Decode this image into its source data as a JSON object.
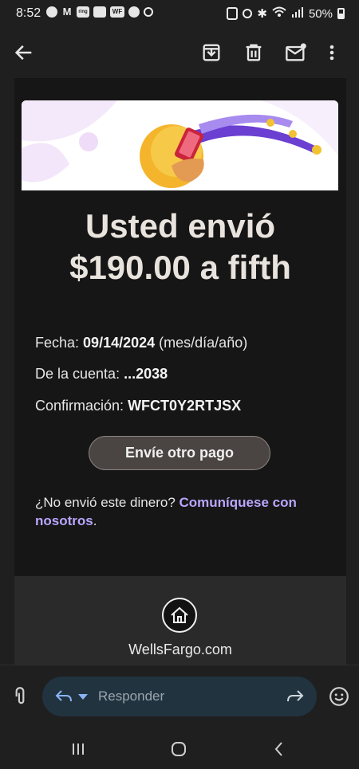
{
  "status_bar": {
    "time": "8:52",
    "notification_icons": [
      "chat-bubble-icon",
      "gmail-icon",
      "ring-icon",
      "app-icon-a",
      "wells-fargo-icon",
      "reddit-icon",
      "target-icon"
    ],
    "notification_labels": [
      "",
      "M",
      "ring",
      "",
      "WF",
      "",
      ""
    ],
    "battery": "50%"
  },
  "toolbar": {
    "back": "back-arrow-icon",
    "archive": "archive-icon",
    "delete": "trash-icon",
    "mark_unread": "mail-unread-icon",
    "more": "more-vert-icon"
  },
  "email": {
    "headline_line1": "Usted envió",
    "headline_line2": "$190.00 a fifth",
    "date_label": "Fecha:",
    "date_value": "09/14/2024",
    "date_format": "(mes/día/año)",
    "account_label": "De la cuenta:",
    "account_value": "...2038",
    "confirmation_label": "Confirmación:",
    "confirmation_value": "WFCT0Y2RTJSX",
    "send_again_button": "Envíe otro pago",
    "not_sent_text": "¿No envió este dinero?",
    "contact_link": "Comuníquese con nosotros",
    "contact_suffix": ".",
    "footer_link": "WellsFargo.com"
  },
  "reply_bar": {
    "placeholder": "Responder"
  },
  "colors": {
    "background": "#1f1f1f",
    "card": "#161616",
    "link": "#b9a6ff",
    "reply_pill": "#223340"
  }
}
